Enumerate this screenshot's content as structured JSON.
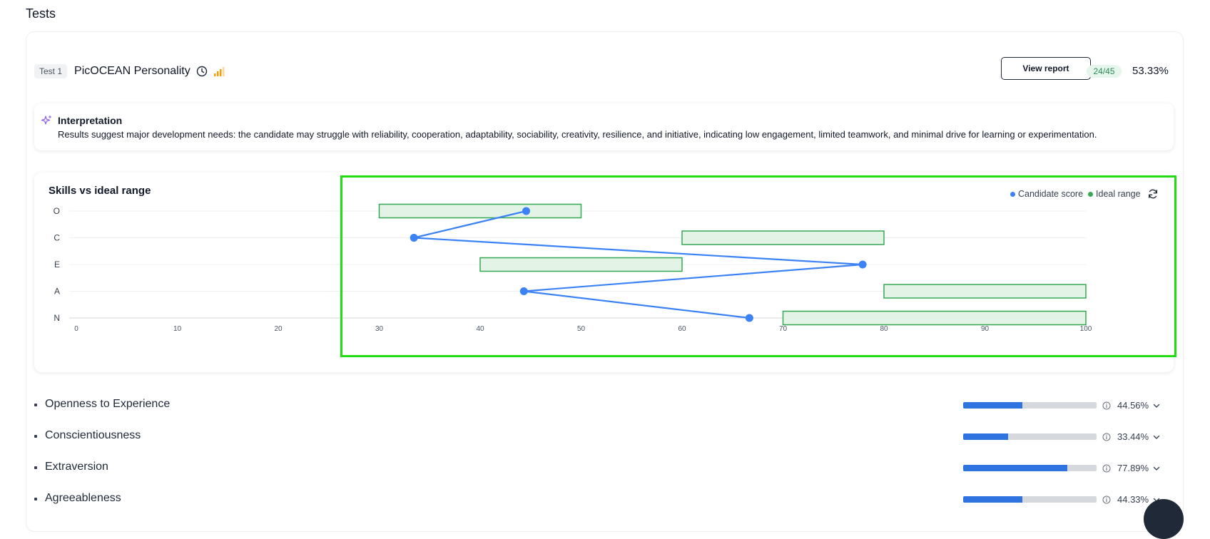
{
  "section_title": "Tests",
  "test": {
    "badge": "Test 1",
    "name": "PicOCEAN Personality",
    "view_report_label": "View report",
    "score_fraction": "24/45",
    "score_percent": "53.33%"
  },
  "interpretation": {
    "title": "Interpretation",
    "text": "Results suggest major development needs: the candidate may struggle with reliability, cooperation, adaptability, sociability, creativity, resilience, and initiative, indicating low engagement, limited teamwork, and minimal drive for learning or experimentation."
  },
  "colors": {
    "accent": "#2f73e0",
    "candidate": "#3b82f6",
    "range_stroke": "#35a853",
    "range_fill": "#e3f3e6",
    "highlight": "#22dd11"
  },
  "chart_data": {
    "type": "scatter",
    "title": "Skills vs ideal range",
    "legend": [
      "Candidate score",
      "Ideal range"
    ],
    "legend_position": "top-right",
    "categories": [
      "O",
      "C",
      "E",
      "A",
      "N"
    ],
    "xlim": [
      0,
      100
    ],
    "xticks": [
      0,
      10,
      20,
      30,
      40,
      50,
      60,
      70,
      80,
      90,
      100
    ],
    "grid": true,
    "series": [
      {
        "name": "Candidate score",
        "values": [
          44.56,
          33.44,
          77.89,
          44.33,
          66.67
        ]
      }
    ],
    "ideal_ranges": [
      [
        30,
        50
      ],
      [
        60,
        80
      ],
      [
        40,
        60
      ],
      [
        80,
        100
      ],
      [
        70,
        100
      ]
    ]
  },
  "skills": [
    {
      "label": "Openness to Experience",
      "value": 44.56,
      "pct": "44.56%"
    },
    {
      "label": "Conscientiousness",
      "value": 33.44,
      "pct": "33.44%"
    },
    {
      "label": "Extraversion",
      "value": 77.89,
      "pct": "77.89%"
    },
    {
      "label": "Agreeableness",
      "value": 44.33,
      "pct": "44.33%"
    }
  ]
}
